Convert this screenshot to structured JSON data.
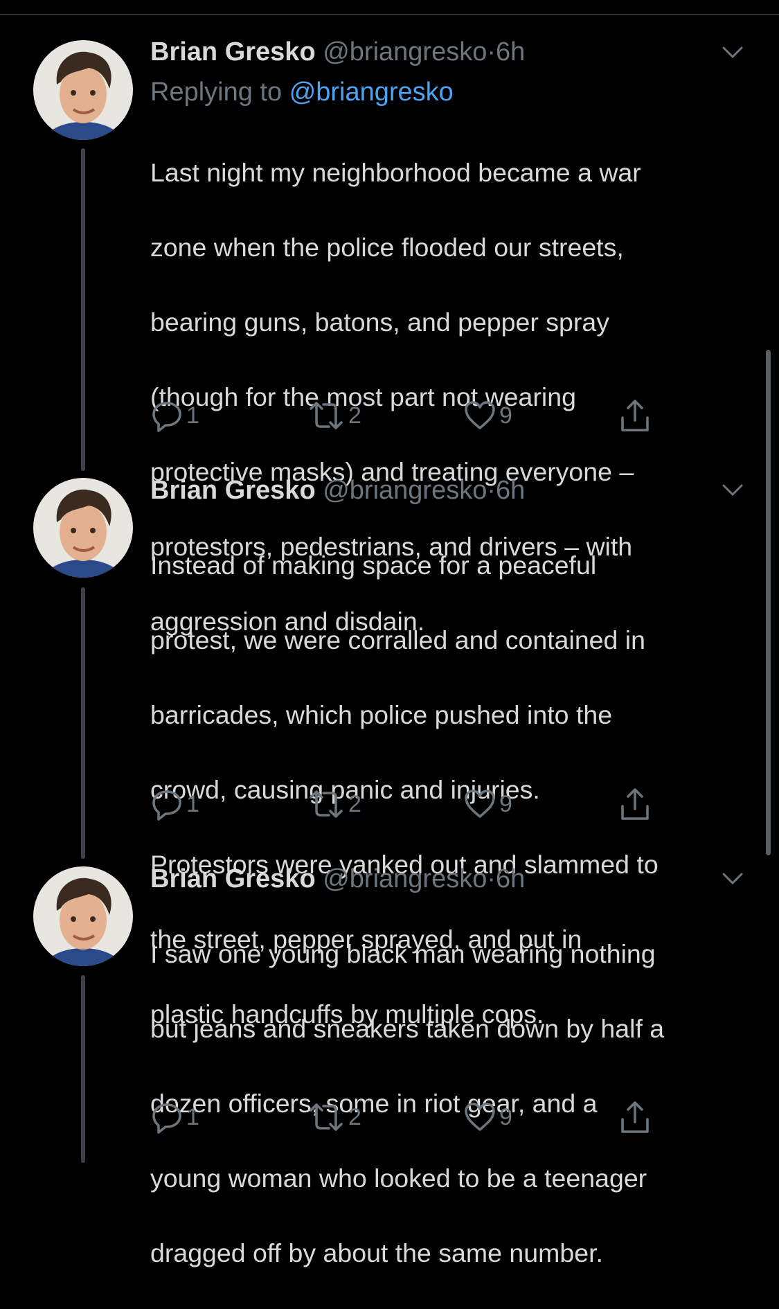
{
  "tweets": [
    {
      "name": "Brian Gresko",
      "handle": "@briangresko",
      "separator": "·",
      "time": "6h",
      "replying_prefix": "Replying to",
      "replying_to": "@briangresko",
      "lines": [
        "Last night my neighborhood became a war",
        "zone when the police flooded our streets,",
        "bearing guns, batons, and pepper spray",
        "(though for the most part not wearing",
        "protective masks) and treating everyone –",
        "protestors, pedestrians, and drivers – with",
        "aggression and disdain."
      ],
      "replies": "1",
      "retweets": "2",
      "likes": "9"
    },
    {
      "name": "Brian Gresko",
      "handle": "@briangresko",
      "separator": "·",
      "time": "6h",
      "lines": [
        "Instead of making space for a peaceful",
        "protest, we were corralled and contained in",
        "barricades, which police pushed into the",
        "crowd, causing panic and injuries.",
        "Protestors were yanked out and slammed to",
        "the street, pepper sprayed, and put in",
        "plastic handcuffs by multiple cops."
      ],
      "replies": "1",
      "retweets": "2",
      "likes": "9"
    },
    {
      "name": "Brian Gresko",
      "handle": "@briangresko",
      "separator": "·",
      "time": "6h",
      "lines": [
        "I saw one young black man wearing nothing",
        "but jeans and sneakers taken down by half a",
        "dozen officers, some in riot gear, and a",
        "young woman who looked to be a teenager",
        "dragged off by about the same number."
      ],
      "replies": "1",
      "retweets": "2",
      "likes": "9"
    }
  ],
  "icons": {
    "reply": "reply-icon",
    "retweet": "retweet-icon",
    "like": "heart-icon",
    "share": "share-icon",
    "caret": "chevron-down-icon"
  },
  "colors": {
    "background": "#000000",
    "text": "#d9d9d9",
    "muted": "#6e767d",
    "link": "#4da3f1",
    "thread_line": "#3d4145"
  }
}
